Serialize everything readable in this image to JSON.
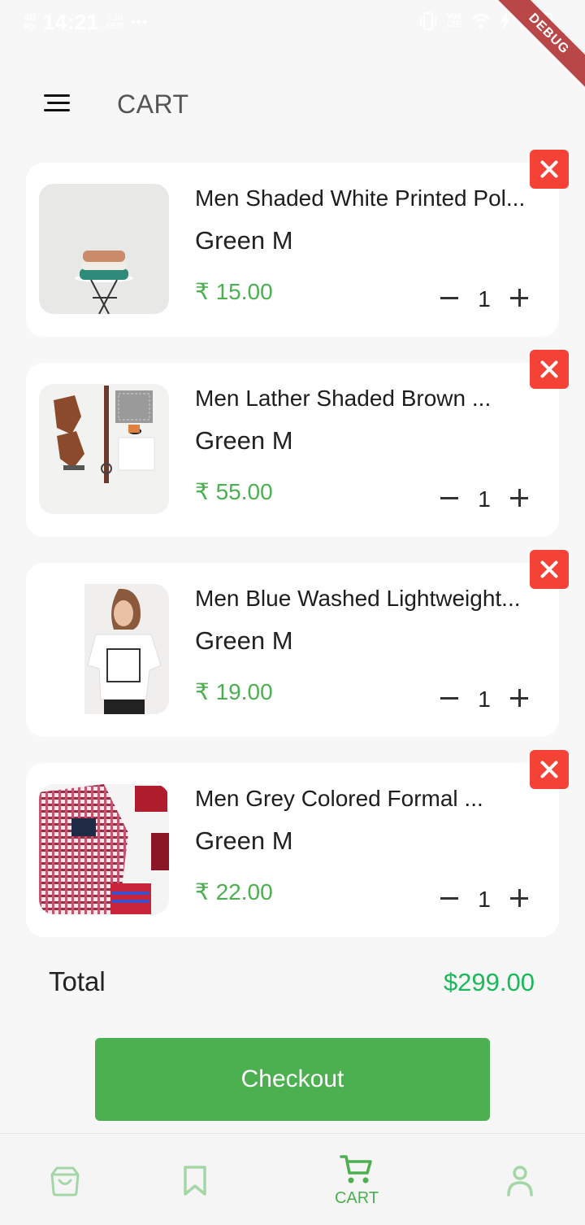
{
  "status_bar": {
    "network": "4G",
    "signal": "Rx",
    "time": "14:21",
    "speed_value": "0.10",
    "speed_unit": "KB/S",
    "more": "•••",
    "volte_top": "Vo4",
    "volte_bottom": "LTE",
    "battery": "94"
  },
  "debug_banner": "DEBUG",
  "header": {
    "title": "CART"
  },
  "currency_symbol": "₹",
  "cart_items": [
    {
      "name": "Men Shaded White Printed Pol...",
      "variant": "Green M",
      "price": "₹ 15.00",
      "quantity": "1"
    },
    {
      "name": "Men Lather Shaded Brown ...",
      "variant": "Green M",
      "price": "₹ 55.00",
      "quantity": "1"
    },
    {
      "name": "Men Blue Washed Lightweight...",
      "variant": "Green M",
      "price": "₹ 19.00",
      "quantity": "1"
    },
    {
      "name": "Men Grey Colored Formal ...",
      "variant": "Green M",
      "price": "₹ 22.00",
      "quantity": "1"
    }
  ],
  "total": {
    "label": "Total",
    "value": "$299.00"
  },
  "checkout": {
    "label": "Checkout"
  },
  "bottom_nav": {
    "items": [
      {
        "icon": "shopping-bag-icon",
        "label": ""
      },
      {
        "icon": "bookmark-icon",
        "label": ""
      },
      {
        "icon": "cart-icon",
        "label": "CART",
        "active": true
      },
      {
        "icon": "user-icon",
        "label": ""
      }
    ]
  },
  "colors": {
    "accent": "#4caf50",
    "price": "#4caf50",
    "total": "#1cb85c",
    "remove": "#f44336",
    "background": "#f7f7f7",
    "card": "#ffffff",
    "nav_inactive": "#a5d6a7"
  }
}
